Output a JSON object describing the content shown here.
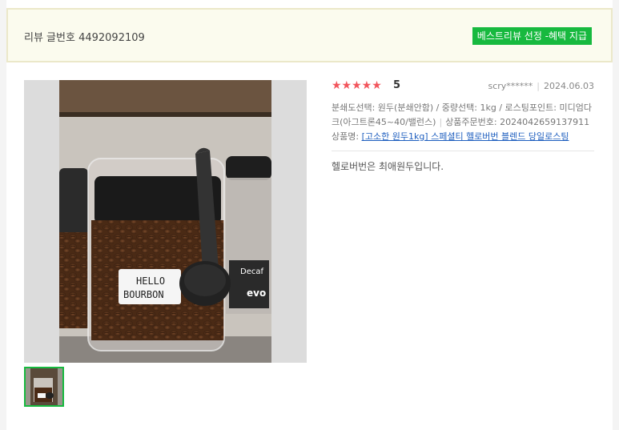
{
  "header": {
    "review_number": "리뷰 글번호 4492092109",
    "best_badge": "베스트리뷰 선정 -혜택 지급"
  },
  "review": {
    "stars": "★★★★★",
    "score": "5",
    "author": "scry******",
    "date": "2024.06.03",
    "options": "분쇄도선택: 원두(분쇄안함) / 중량선택: 1kg / 로스팅포인트: 미디엄다크(아그트론45~40/밸런스)",
    "order_label": "상품주문번호:",
    "order_number": "2024042659137911",
    "product_label": "상품명: ",
    "product_name": "[고소한 원두1kg] 스페셜티 헬로버번 블렌드 당일로스팅",
    "body": "헬로버번은 최애원두입니다."
  },
  "photo": {
    "label_line1": "HELLO",
    "label_line2": "BOURBON",
    "right_label": "Decaf",
    "right_brand": "evo"
  },
  "colors": {
    "badge": "#17b93f",
    "star": "#f2555c",
    "link": "#1f5fbf",
    "header_bg": "#fbfbee"
  }
}
